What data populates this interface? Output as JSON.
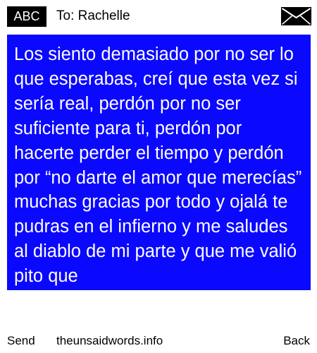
{
  "header": {
    "mode_label": "ABC",
    "recipient": "To: Rachelle",
    "envelope_icon": "envelope-icon"
  },
  "message": {
    "text": "Los siento demasiado por no ser lo que esperabas, creí que esta vez si sería real, perdón por no ser suficiente para ti, perdón por hacerte perder el tiempo y perdón por “no darte el amor que merecías” muchas gracias por todo y ojalá te pudras en el infierno y me saludes al diablo de mi parte y que me valió pito que"
  },
  "footer": {
    "send_label": "Send",
    "site_label": "theunsaidwords.info",
    "back_label": "Back"
  },
  "colors": {
    "message_background": "#0b08ff",
    "message_text": "#ffffff",
    "badge_background": "#000000"
  }
}
